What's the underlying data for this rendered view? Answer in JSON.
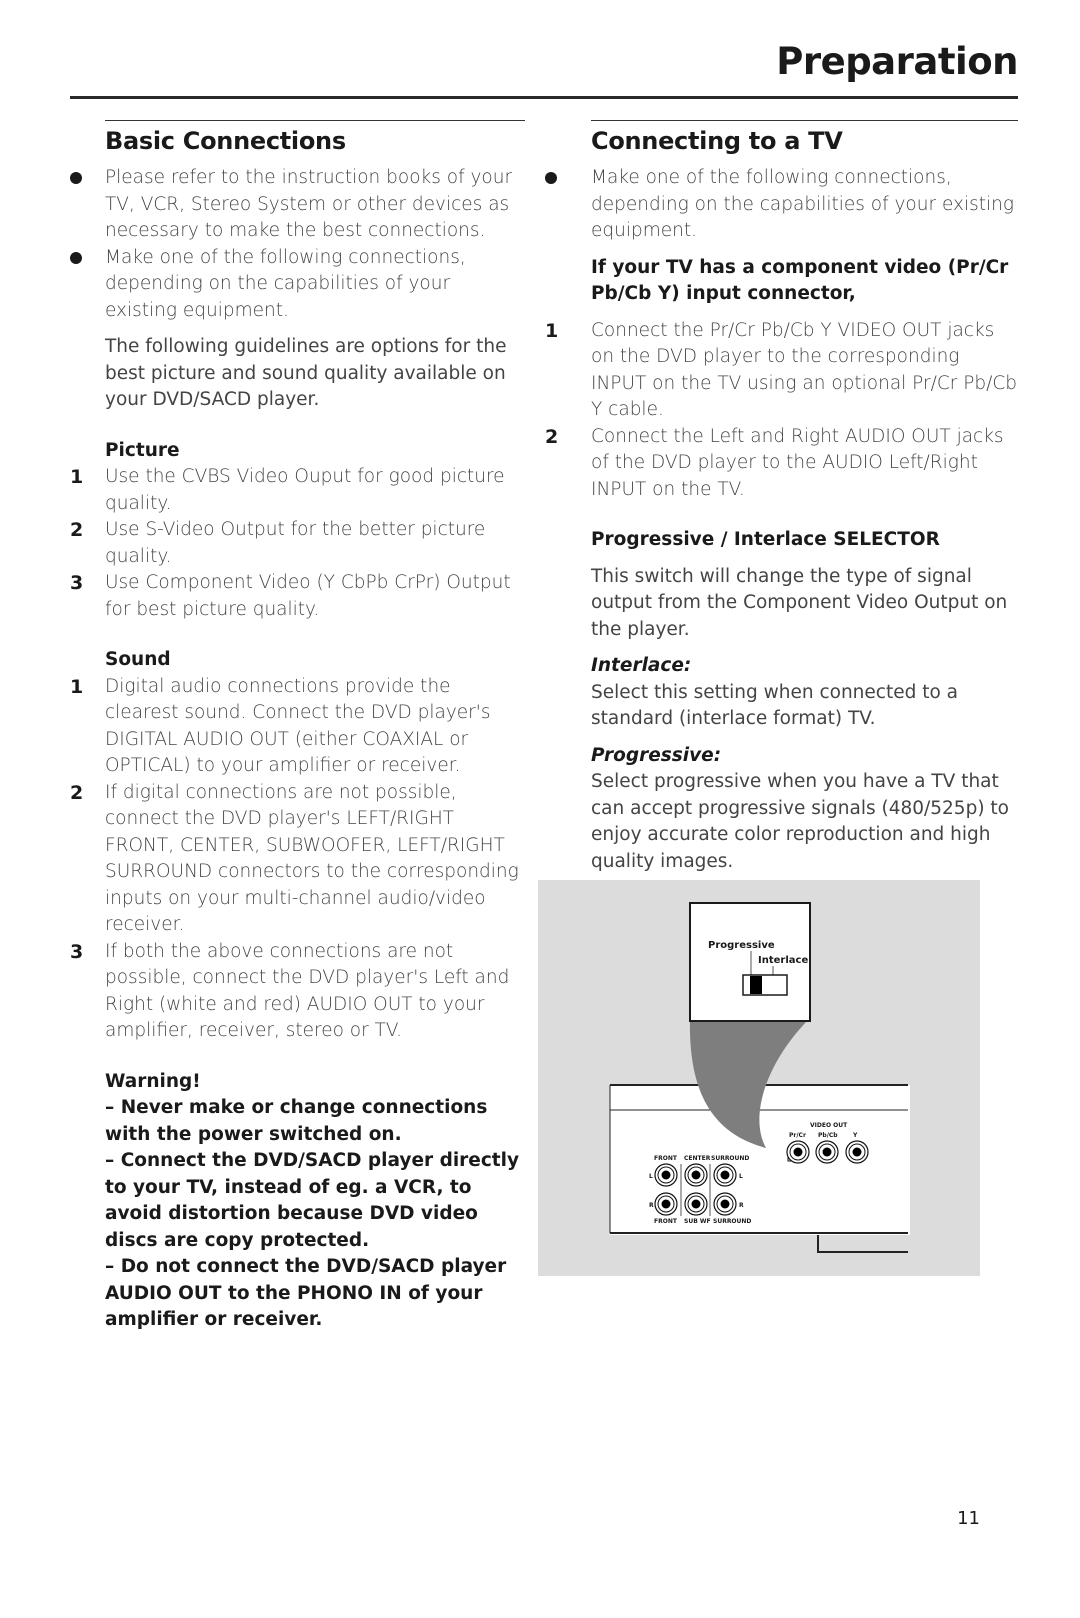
{
  "header": {
    "title": "Preparation"
  },
  "left": {
    "title": "Basic Connections",
    "bullets": [
      "Please refer to the instruction books of your TV, VCR, Stereo System or other devices as necessary to make the best connections.",
      "Make one of the following connections, depending on the capabilities of your existing equipment."
    ],
    "intro": "The following guidelines are options for the best picture and sound quality available on your DVD/SACD player.",
    "picture": {
      "heading": "Picture",
      "items": [
        {
          "n": "1",
          "text": "Use the CVBS Video Ouput for good picture quality."
        },
        {
          "n": "2",
          "text": "Use S-Video Output for the better picture quality."
        },
        {
          "n": "3",
          "text": "Use Component Video (Y CbPb CrPr) Output for best picture quality."
        }
      ]
    },
    "sound": {
      "heading": "Sound",
      "items": [
        {
          "n": "1",
          "text": "Digital audio connections provide the clearest sound. Connect the DVD player's DIGITAL AUDIO OUT (either COAXIAL or OPTICAL) to your amplifier or receiver."
        },
        {
          "n": "2",
          "text": "If digital connections are not possible, connect the DVD player's LEFT/RIGHT FRONT, CENTER, SUBWOOFER, LEFT/RIGHT SURROUND connectors to the corresponding inputs on your multi-channel audio/video receiver."
        },
        {
          "n": "3",
          "text": "If both the above connections are not possible, connect the DVD player's Left and Right (white and red) AUDIO OUT to your amplifier, receiver, stereo or TV."
        }
      ]
    },
    "warning": {
      "heading": "Warning!",
      "lines": [
        "– Never make or change connections with the power switched on.",
        "– Connect the DVD/SACD player directly to your TV, instead of eg. a VCR,  to avoid distortion because DVD video discs are copy protected.",
        "– Do not connect the DVD/SACD player AUDIO OUT to the PHONO IN of your amplifier or receiver."
      ]
    }
  },
  "right": {
    "title": "Connecting to a TV",
    "bullet": "Make one of the following connections, depending on the capabilities of your existing equipment.",
    "component_heading": "If your TV has a component video (Pr/Cr Pb/Cb Y) input connector,",
    "steps": [
      {
        "n": "1",
        "text": "Connect the Pr/Cr Pb/Cb Y VIDEO OUT jacks on the DVD player to the corresponding INPUT on the TV using an optional Pr/Cr Pb/Cb Y cable."
      },
      {
        "n": "2",
        "text": "Connect the Left and Right AUDIO OUT jacks of the DVD player to the AUDIO Left/Right INPUT on the TV."
      }
    ],
    "selector_heading": "Progressive / Interlace SELECTOR",
    "selector_text": "This switch will change the type of signal output from the Component Video Output on the player.",
    "interlace": {
      "label": "Interlace:",
      "text": "Select this setting when connected to a standard (interlace format) TV."
    },
    "progressive": {
      "label": "Progressive:",
      "text": "Select progressive when you have a TV that can accept progressive signals (480/525p) to enjoy accurate color reproduction and high quality images."
    }
  },
  "figure": {
    "callout_progressive": "Progressive",
    "callout_interlace": "Interlace",
    "video_out": "VIDEO OUT",
    "video_jacks": [
      "Pr/Cr",
      "Pb/Cb",
      "Y"
    ],
    "top_labels": [
      "FRONT",
      "CENTER",
      "SURROUND"
    ],
    "bottom_labels": [
      "FRONT",
      "SUB WF",
      "SURROUND"
    ],
    "left_label": "L",
    "right_label": "R"
  },
  "footer": {
    "page_number": "11"
  }
}
